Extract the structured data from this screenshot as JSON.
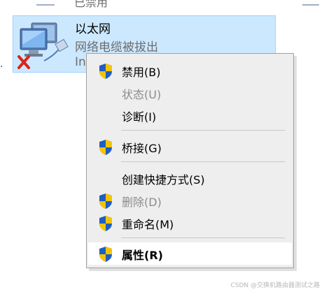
{
  "top_partial": {
    "label": "已禁用"
  },
  "adapter": {
    "name": "以太网",
    "status": "网络电缆被拔出",
    "device": "In"
  },
  "context_menu": {
    "items": [
      {
        "label": "禁用(B)",
        "icon": "uac-shield-icon",
        "enabled": true
      },
      {
        "label": "状态(U)",
        "icon": "",
        "enabled": false
      },
      {
        "label": "诊断(I)",
        "icon": "",
        "enabled": true
      },
      {
        "label": "桥接(G)",
        "icon": "uac-shield-icon",
        "enabled": true
      },
      {
        "label": "创建快捷方式(S)",
        "icon": "",
        "enabled": true
      },
      {
        "label": "删除(D)",
        "icon": "uac-shield-icon",
        "enabled": false
      },
      {
        "label": "重命名(M)",
        "icon": "uac-shield-icon",
        "enabled": true
      },
      {
        "label": "属性(R)",
        "icon": "uac-shield-icon",
        "enabled": true,
        "bold": true,
        "highlighted": true
      }
    ]
  },
  "watermark": "CSDN @交换机路由器测试之路",
  "colors": {
    "selection_bg": "#cce8ff",
    "menu_bg": "#eeeeee",
    "shield_blue": "#1f5fbf",
    "shield_yellow": "#f5c400",
    "error_red": "#d9261c"
  }
}
